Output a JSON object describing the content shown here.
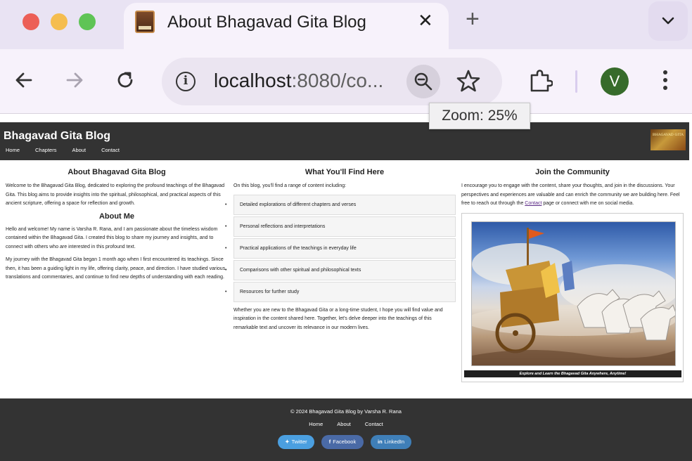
{
  "browser": {
    "tab_title": "About Bhagavad Gita Blog",
    "url_host": "localhost",
    "url_rest": ":8080/co...",
    "zoom_tooltip": "Zoom: 25%",
    "profile_initial": "V",
    "icons": [
      "close-icon",
      "plus-icon",
      "chevron-down-icon",
      "back-arrow-icon",
      "forward-arrow-icon",
      "reload-icon",
      "info-icon",
      "zoom-out-icon",
      "star-icon",
      "extensions-icon",
      "more-vert-icon"
    ]
  },
  "site": {
    "title": "Bhagavad Gita Blog",
    "nav": [
      "Home",
      "Chapters",
      "About",
      "Contact"
    ],
    "logo_text": "BHAGAVAD GITA"
  },
  "about": {
    "heading": "About Bhagavad Gita Blog",
    "intro": "Welcome to the Bhagavad Gita Blog, dedicated to exploring the profound teachings of the Bhagavad Gita. This blog aims to provide insights into the spiritual, philosophical, and practical aspects of this ancient scripture, offering a space for reflection and growth.",
    "about_me_heading": "About Me",
    "para1": "Hello and welcome! My name is Varsha R. Rana, and I am passionate about the timeless wisdom contained within the Bhagavad Gita. I created this blog to share my journey and insights, and to connect with others who are interested in this profound text.",
    "para2": "My journey with the Bhagavad Gita began 1 month ago when I first encountered its teachings. Since then, it has been a guiding light in my life, offering clarity, peace, and direction. I have studied various translations and commentaries, and continue to find new depths of understanding with each reading."
  },
  "find": {
    "heading": "What You'll Find Here",
    "intro": "On this blog, you'll find a range of content including:",
    "items": [
      "Detailed explorations of different chapters and verses",
      "Personal reflections and interpretations",
      "Practical applications of the teachings in everyday life",
      "Comparisons with other spiritual and philosophical texts",
      "Resources for further study"
    ],
    "outro": "Whether you are new to the Bhagavad Gita or a long-time student, I hope you will find value and inspiration in the content shared here. Together, let's delve deeper into the teachings of this remarkable text and uncover its relevance in our modern lives."
  },
  "community": {
    "heading": "Join the Community",
    "text_before": "I encourage you to engage with the content, share your thoughts, and join in the discussions. Your perspectives and experiences are valuable and can enrich the community we are building here. Feel free to reach out through the ",
    "link": "Contact",
    "text_after": " page or connect with me on social media.",
    "caption": "Explore and Learn the Bhagavad Gita Anywhere, Anytime!"
  },
  "footer": {
    "copyright": "© 2024 Bhagavad Gita Blog by Varsha R. Rana",
    "nav": [
      "Home",
      "About",
      "Contact"
    ],
    "social": [
      "Twitter",
      "Facebook",
      "LinkedIn"
    ]
  }
}
